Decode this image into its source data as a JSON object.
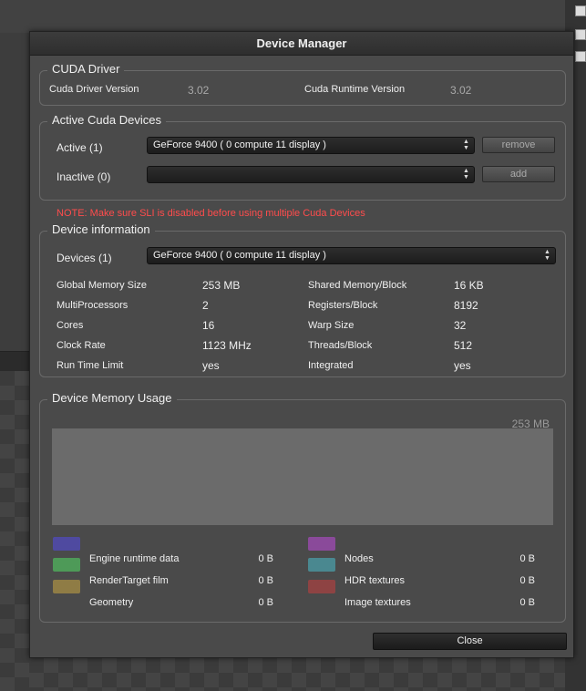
{
  "dialog": {
    "title": "Device Manager",
    "close_label": "Close"
  },
  "cuda_driver": {
    "title": "CUDA Driver",
    "driver_version_label": "Cuda Driver Version",
    "driver_version": "3.02",
    "runtime_version_label": "Cuda Runtime Version",
    "runtime_version": "3.02"
  },
  "active_devices": {
    "title": "Active Cuda Devices",
    "active_label": "Active (1)",
    "active_selected": "GeForce 9400 ( 0 compute 11 display )",
    "remove_label": "remove",
    "inactive_label": "Inactive (0)",
    "inactive_selected": "",
    "add_label": "add"
  },
  "note": "NOTE: Make sure SLI is disabled before using multiple Cuda Devices",
  "device_info": {
    "title": "Device information",
    "devices_label": "Devices (1)",
    "devices_selected": "GeForce 9400 ( 0 compute 11 display )",
    "left": [
      {
        "label": "Global Memory Size",
        "value": "253 MB"
      },
      {
        "label": "MultiProcessors",
        "value": "2"
      },
      {
        "label": "Cores",
        "value": "16"
      },
      {
        "label": "Clock Rate",
        "value": "1123 MHz"
      },
      {
        "label": "Run Time Limit",
        "value": "yes"
      }
    ],
    "right": [
      {
        "label": "Shared Memory/Block",
        "value": "16 KB"
      },
      {
        "label": "Registers/Block",
        "value": "8192"
      },
      {
        "label": "Warp Size",
        "value": "32"
      },
      {
        "label": "Threads/Block",
        "value": "512"
      },
      {
        "label": "Integrated",
        "value": "yes"
      }
    ]
  },
  "memory_usage": {
    "title": "Device Memory Usage",
    "total": "253 MB",
    "legend_left": [
      {
        "label": "",
        "value": "",
        "color": "#4f4aa0"
      },
      {
        "label": "Engine runtime data",
        "value": "0 B",
        "color": "#4e9a58"
      },
      {
        "label": "RenderTarget film",
        "value": "0 B",
        "color": "#8f7c45"
      },
      {
        "label": "Geometry",
        "value": "0 B",
        "color": ""
      }
    ],
    "legend_right": [
      {
        "label": "",
        "value": "",
        "color": "#8a4a9a"
      },
      {
        "label": "Nodes",
        "value": "0 B",
        "color": ""
      },
      {
        "label": "HDR textures",
        "value": "0 B",
        "color": "#4a8890"
      },
      {
        "label": "Image textures",
        "value": "0 B",
        "color": "#8e4343"
      }
    ]
  },
  "colors": {
    "note": "#ff4c4c",
    "background": "#4a4a4a"
  }
}
